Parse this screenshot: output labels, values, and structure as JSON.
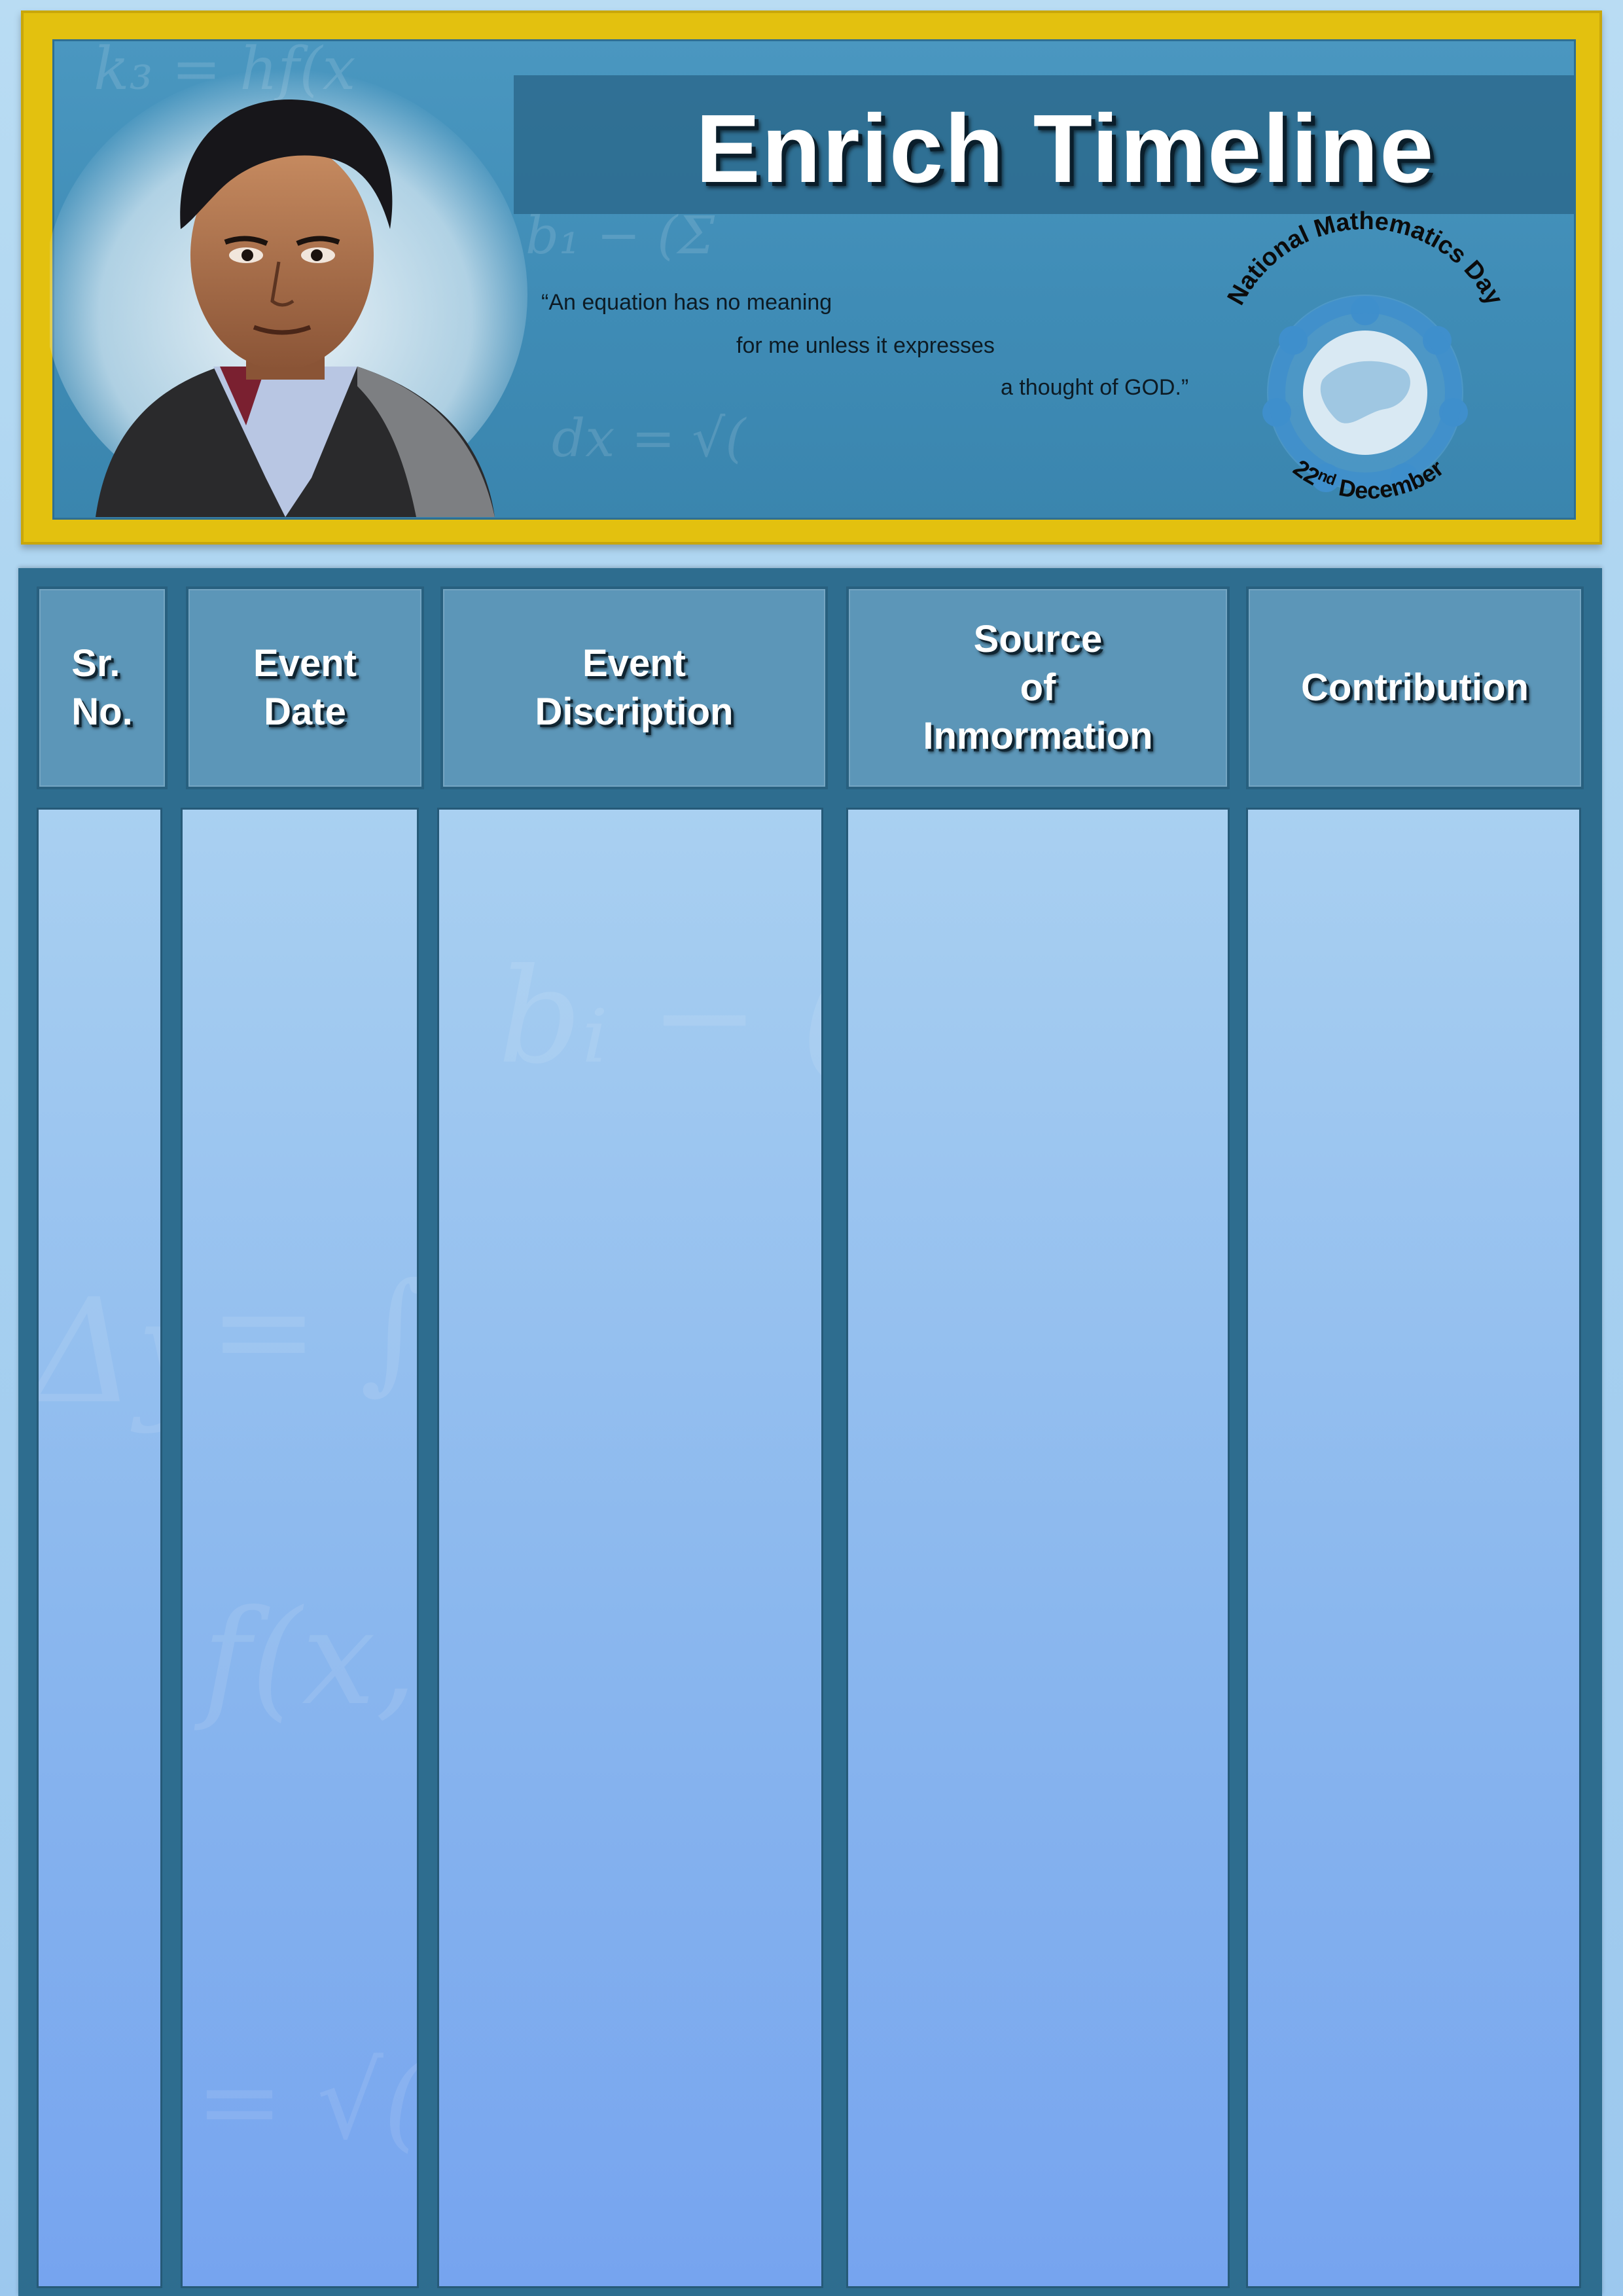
{
  "banner": {
    "title": "Enrich Timeline",
    "quote_lines": [
      "“An equation has no meaning",
      "for me unless it expresses",
      "a thought of GOD.”"
    ],
    "badge": {
      "arc_text": "National Mathematics Day",
      "date_day": "22",
      "date_suffix": "nd",
      "date_month": "December",
      "icon": "globe-with-people-icon"
    },
    "portrait": "portrait-illustration",
    "colors": {
      "frame": "#e3c10f",
      "panel": "#4a97c0",
      "title": "#ffffff"
    }
  },
  "table": {
    "columns": [
      {
        "label": "Sr.\nNo."
      },
      {
        "label": "Event\nDate"
      },
      {
        "label": "Event\nDiscription"
      },
      {
        "label": "Source\nof\nInmormation"
      },
      {
        "label": "Contribution"
      }
    ],
    "colors": {
      "frame": "#2e6d8f",
      "header": "#5c96b8",
      "cell_top": "#a9d0f1",
      "cell_bottom": "#76a4ef"
    }
  }
}
